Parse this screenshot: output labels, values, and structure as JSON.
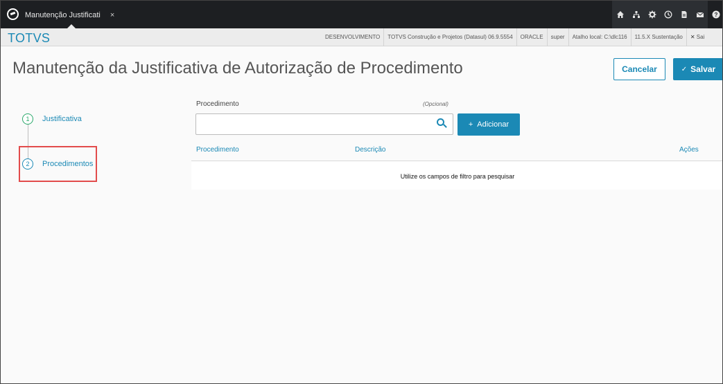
{
  "app": {
    "tab_title": "Manutenção Justificati",
    "tab_close": "×",
    "brand": "TOTVS"
  },
  "topbar_icons": [
    "home-icon",
    "org-chart-icon",
    "settings-icon",
    "clock-icon",
    "document-icon",
    "mail-icon",
    "help-icon"
  ],
  "info_bar": {
    "items": [
      "DESENVOLVIMENTO",
      "TOTVS Construção e Projetos (Datasul) 06.9.5554",
      "ORACLE",
      "super",
      "Atalho local: C:\\dlc116",
      "11.5.X Sustentação"
    ],
    "exit_label": "Sai",
    "exit_icon": "✕"
  },
  "page": {
    "title": "Manutenção da Justificativa de Autorização de Procedimento"
  },
  "actions": {
    "cancel_label": "Cancelar",
    "save_label": "Salvar",
    "save_icon": "✓"
  },
  "stepper": {
    "steps": [
      {
        "number": "1",
        "label": "Justificativa"
      },
      {
        "number": "2",
        "label": "Procedimentos"
      }
    ]
  },
  "form": {
    "procedimento_label": "Procedimento",
    "optional_label": "(Opcional)",
    "search_value": "",
    "add_label": "Adicionar",
    "add_icon": "+"
  },
  "table": {
    "columns": [
      "Procedimento",
      "Descrição",
      "Ações"
    ],
    "empty_message": "Utilize os campos de filtro para pesquisar"
  },
  "colors": {
    "accent": "#1b89b5",
    "topbar": "#1d1f22",
    "highlight": "#e24b4b"
  }
}
